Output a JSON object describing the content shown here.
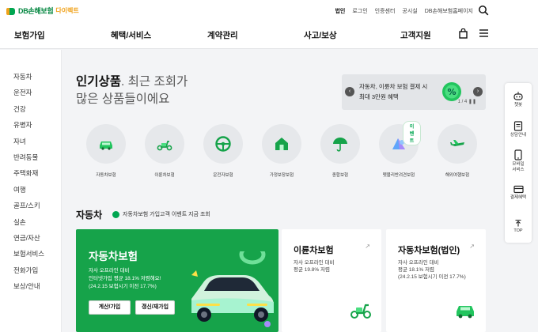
{
  "logo": {
    "brand": "DB손해보험",
    "sub": "다이렉트"
  },
  "util_links": [
    "법인",
    "로그인",
    "인증센터",
    "공시실",
    "DB손해보험홈페이지"
  ],
  "nav": {
    "items": [
      "보험가입",
      "혜택/서비스",
      "계약관리",
      "사고/보상",
      "고객지원"
    ]
  },
  "sidebar": {
    "items": [
      "자동차",
      "운전자",
      "건강",
      "유병자",
      "자녀",
      "반려동물",
      "주택화재",
      "여행",
      "골프/스키",
      "실손",
      "연금/자산",
      "보험서비스",
      "전화가입",
      "보상/안내"
    ]
  },
  "hero": {
    "line1_bold": "인기상품",
    "line1_rest": ". 최근 조회가",
    "line2": "많은 상품들이에요"
  },
  "banner": {
    "text_line1": "자동차, 이륜차 보험 결제 시",
    "text_line2": "최대 3만원 혜택",
    "page": "1 / 4"
  },
  "products": [
    {
      "label": "자동차보험",
      "icon": "car-icon"
    },
    {
      "label": "이륜차보험",
      "icon": "scooter-icon"
    },
    {
      "label": "운전자보험",
      "icon": "steering-wheel-icon"
    },
    {
      "label": "가정보장보험",
      "icon": "house-icon"
    },
    {
      "label": "종합보험",
      "icon": "umbrella-icon"
    },
    {
      "label": "펫블리반려견보험",
      "icon": "pet-icon",
      "badge": "이벤트"
    },
    {
      "label": "해외여행보험",
      "icon": "airplane-icon"
    }
  ],
  "section": {
    "title": "자동차",
    "note": "자동차보험 가입고객 이벤트 지금 조회"
  },
  "card_main": {
    "title": "자동차보험",
    "desc1": "자사 오프라인 대비",
    "desc2": "인터넷가입 평균 18.1% 저렴해요!",
    "desc3": "(24.2.15 보험시기 이전 17.7%)",
    "btn1": "계산/가입",
    "btn2": "갱신/재가입"
  },
  "card_moto": {
    "title": "이륜차보험",
    "desc1": "자사 오프라인 대비",
    "desc2": "평균 19.8% 저렴"
  },
  "card_corp": {
    "title": "자동차보험(법인)",
    "desc1": "자사 오프라인 대비",
    "desc2": "평균 18.1% 저렴",
    "desc3": "(24.2.15 보험시기 이전 17.7%)"
  },
  "quick_menu": [
    "챗봇",
    "상담안내",
    "모바일",
    "서비스",
    "결제혜택",
    "TOP"
  ],
  "colors": {
    "brand_green": "#16a34a",
    "accent_orange": "#f0a21b"
  }
}
